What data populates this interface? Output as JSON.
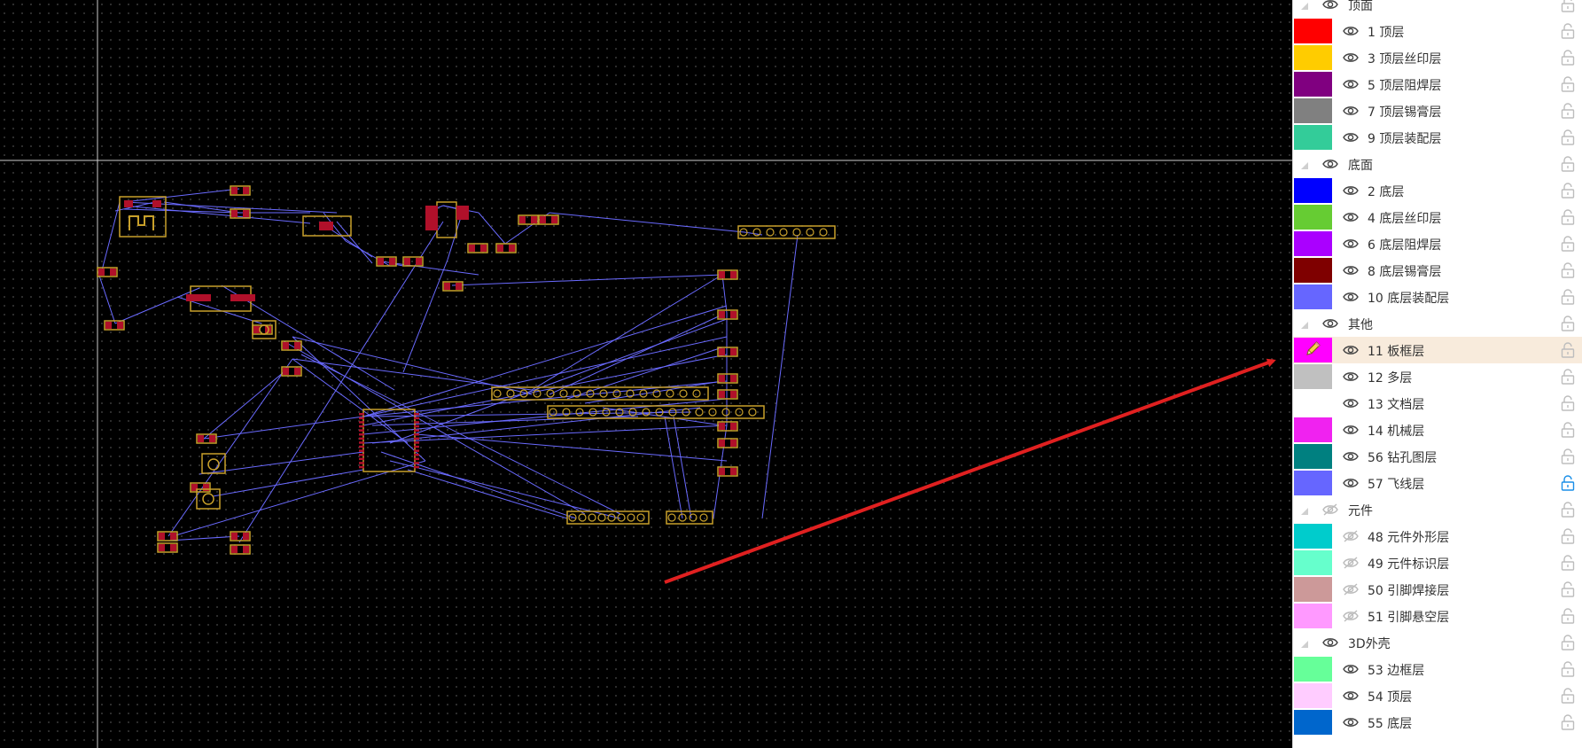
{
  "layer_panel": {
    "groups": [
      {
        "label": "顶面",
        "visible": true,
        "layers": [
          {
            "label": "1 顶层",
            "color": "#ff0000",
            "visible": true
          },
          {
            "label": "3 顶层丝印层",
            "color": "#ffcc00",
            "visible": true
          },
          {
            "label": "5 顶层阻焊层",
            "color": "#800080",
            "visible": true
          },
          {
            "label": "7 顶层锡膏层",
            "color": "#808080",
            "visible": true
          },
          {
            "label": "9 顶层装配层",
            "color": "#33cc99",
            "visible": true
          }
        ]
      },
      {
        "label": "底面",
        "visible": true,
        "layers": [
          {
            "label": "2 底层",
            "color": "#0000ff",
            "visible": true
          },
          {
            "label": "4 底层丝印层",
            "color": "#66cc33",
            "visible": true
          },
          {
            "label": "6 底层阻焊层",
            "color": "#aa00ff",
            "visible": true
          },
          {
            "label": "8 底层锡膏层",
            "color": "#7f0000",
            "visible": true
          },
          {
            "label": "10 底层装配层",
            "color": "#6666ff",
            "visible": true
          }
        ]
      },
      {
        "label": "其他",
        "visible": true,
        "layers": [
          {
            "label": "11 板框层",
            "color": "#ff00ff",
            "visible": true,
            "active": true,
            "icon": "pencil-icon"
          },
          {
            "label": "12 多层",
            "color": "#c0c0c0",
            "visible": true
          },
          {
            "label": "13 文档层",
            "color": "#ffffff",
            "visible": true
          },
          {
            "label": "14 机械层",
            "color": "#f022f0",
            "visible": true
          },
          {
            "label": "56 钻孔图层",
            "color": "#008080",
            "visible": true
          },
          {
            "label": "57 飞线层",
            "color": "#6666ff",
            "visible": true,
            "locked": true
          }
        ]
      },
      {
        "label": "元件",
        "visible": false,
        "layers": [
          {
            "label": "48 元件外形层",
            "color": "#00cccc",
            "visible": false
          },
          {
            "label": "49 元件标识层",
            "color": "#66ffcc",
            "visible": false
          },
          {
            "label": "50 引脚焊接层",
            "color": "#cc9999",
            "visible": false
          },
          {
            "label": "51 引脚悬空层",
            "color": "#ff99ff",
            "visible": false
          }
        ]
      },
      {
        "label": "3D外壳",
        "visible": true,
        "layers": [
          {
            "label": "53 边框层",
            "color": "#66ff99",
            "visible": true
          },
          {
            "label": "54 顶层",
            "color": "#ffccff",
            "visible": true
          },
          {
            "label": "55 底层",
            "color": "#0066cc",
            "visible": true
          }
        ]
      }
    ]
  },
  "canvas": {
    "crosshair_color": "#cccccc",
    "ratline_color": "#6a6aff",
    "silk_color": "#c8a02a",
    "pad_color": "#b0102a",
    "annotation_arrow_color": "#e02020"
  }
}
